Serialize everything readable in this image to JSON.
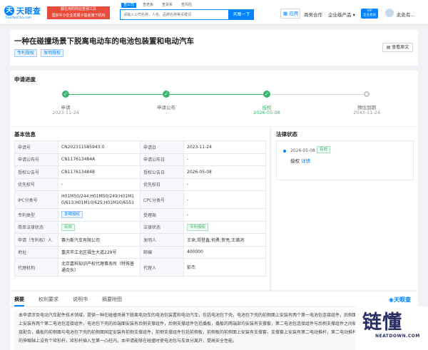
{
  "header": {
    "logo_mark": "天",
    "logo_text": "天眼查",
    "logo_sub": "TianYanCha.com",
    "banner_line1": "都在用的商业查询工具",
    "banner_line2": "国家中小企业发展子基金旗下机构",
    "search_tabs": [
      "查公司",
      "查老板",
      "查关系",
      "查风险"
    ],
    "search_placeholder": "请输入公司名称、人名、品牌名称等关键词",
    "search_button": "天眼一下",
    "apps_label": "应用",
    "nav_business": "商务合作",
    "nav_enterprise": "企业级产品",
    "vip_line1": "VIP",
    "vip_line2": "企业会员",
    "user_name": "此处有..."
  },
  "patent": {
    "title": "一种在碰撞场景下脱离电动车的电池包装置和电动汽车",
    "tags": [
      "专利授权",
      "发明授权"
    ],
    "view_original": "查看原文"
  },
  "progress": {
    "section_title": "申请进度",
    "steps": [
      {
        "label": "申请",
        "date": "2023-11-24",
        "state": "done"
      },
      {
        "label": "申请公布",
        "date": "-",
        "state": "done"
      },
      {
        "label": "授权",
        "date": "2026-05-08",
        "state": "current"
      },
      {
        "label": "预估到期",
        "date": "2043-11-24",
        "state": "todo"
      }
    ]
  },
  "basic_info": {
    "section_title": "基本信息",
    "rows": [
      {
        "k1": "申请号",
        "v1": "CN202311585943.0",
        "k2": "申请日",
        "v2": "2023-11-24"
      },
      {
        "k1": "申请公布号",
        "v1": "CN117613484A",
        "k2": "申请公布日",
        "v2": "-"
      },
      {
        "k1": "授权公告号",
        "v1": "CN117613484B",
        "k2": "授权公告日",
        "v2": "2026-05-08"
      },
      {
        "k1": "优先权号",
        "v1": "-",
        "k2": "优先权日",
        "v2": "-"
      },
      {
        "k1": "IPC分类号",
        "v1": "H01M50/244;H01M50/249;H01M10/613;H01M10/625;H01M10/6551",
        "k2": "CPC分类号",
        "v2": "-"
      },
      {
        "k1": "专利类型",
        "v1": "发明授权",
        "k2": "受理局",
        "v2": "-"
      },
      {
        "k1": "简单法律状态",
        "v1": "有效",
        "k2": "法律状态",
        "v2": "专利授权"
      },
      {
        "k1": "申请（专利权）人",
        "v1": "赛力斯汽车有限公司",
        "k2": "发明人",
        "v2": "王来;郑登鑫;何勇;贺亮;王璜鸿"
      },
      {
        "k1": "地址",
        "v1": "重庆市江北区福生大道229号",
        "k2": "邮编",
        "v2": "400000"
      },
      {
        "k1": "代理机构",
        "v1": "北京嘉科知识产权代理事务所（特殊普通合伙）",
        "k2": "代理人",
        "v2": "彭杰"
      }
    ]
  },
  "legal_status": {
    "section_title": "法律状态",
    "date": "2026-05-08",
    "status": "有效",
    "type": "授权",
    "detail_link": "详情"
  },
  "bottom": {
    "tabs": [
      "摘要",
      "权利要求",
      "说明书",
      "摘要附图"
    ],
    "watermark_logo": "天眼查",
    "abstract": "本申请涉及电动汽车配件技术领域，提供一种在碰撞场景下脱离电动车的电池包装置和电动汽车，包括电池包下壳，电池包下壳的前侧面上安装有两个第一电池包连接组件，后侧面上安装有两个第二电池包连接组件，电池包下壳的后端面安装有后侧支撑组件，后侧支撑组件包括撬板，撬板的两端部均安装有支撑套，第二电池包连接组件与后侧支撑组件之间插接配合，撬板的前侧面与电池包下壳的前侧面固定安装有前侧支撑组件，前侧支撑组件包括前侧板，前侧板的前侧面上安装有支撑套，支撑套上安装有第二电动推杆，第二电动推杆的伸缩轴上设有个矩形杆，矩形杆插入至第一凸柱内，本申请能够在碰撞时使电池包与车体分离开，提高安全性能。"
  },
  "watermark": {
    "main": "链懂",
    "sub": "NEATDOWN.COM"
  }
}
